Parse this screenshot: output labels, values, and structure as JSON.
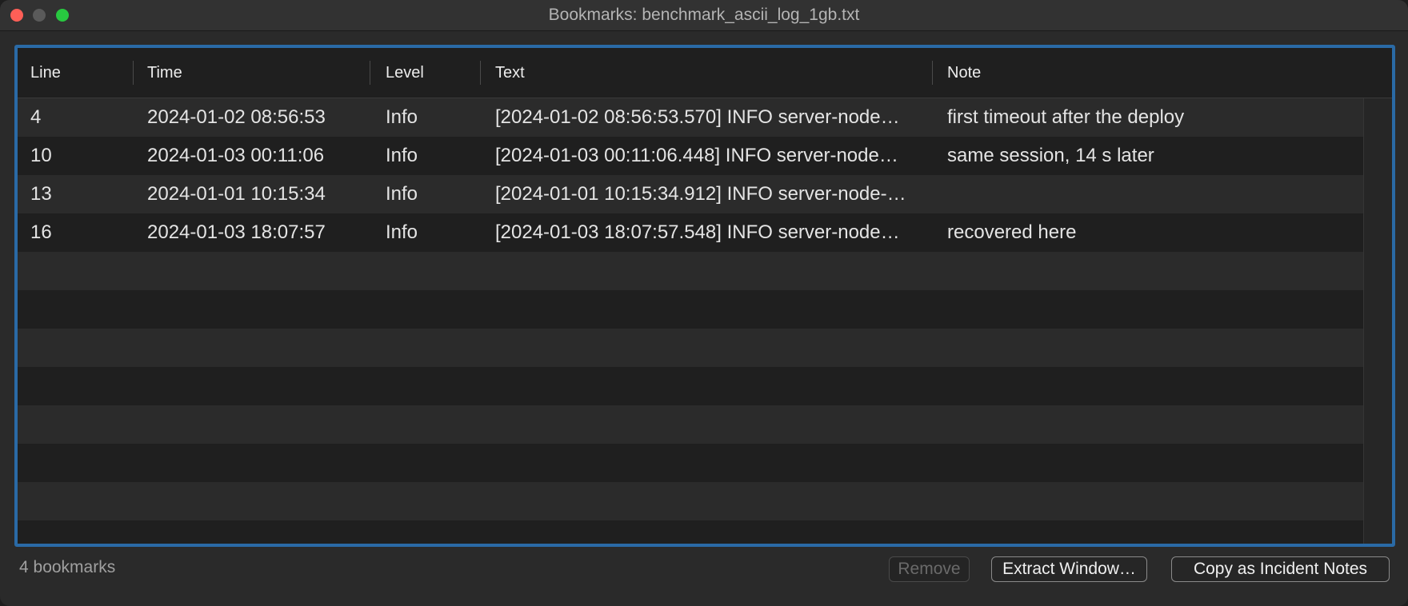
{
  "window": {
    "title": "Bookmarks: benchmark_ascii_log_1gb.txt"
  },
  "table": {
    "columns": [
      "Line",
      "Time",
      "Level",
      "Text",
      "Note"
    ],
    "rows": [
      {
        "line": "4",
        "time": "2024-01-02 08:56:53",
        "level": "Info",
        "text": "[2024-01-02 08:56:53.570] INFO  server-node…",
        "note": "first timeout after the deploy"
      },
      {
        "line": "10",
        "time": "2024-01-03 00:11:06",
        "level": "Info",
        "text": "[2024-01-03 00:11:06.448] INFO  server-node…",
        "note": "same session, 14 s later"
      },
      {
        "line": "13",
        "time": "2024-01-01 10:15:34",
        "level": "Info",
        "text": "[2024-01-01 10:15:34.912] INFO  server-node-…",
        "note": ""
      },
      {
        "line": "16",
        "time": "2024-01-03 18:07:57",
        "level": "Info",
        "text": "[2024-01-03 18:07:57.548] INFO  server-node…",
        "note": "recovered here"
      }
    ]
  },
  "footer": {
    "count_label": "4 bookmarks",
    "remove_label": "Remove",
    "extract_label": "Extract Window…",
    "copy_label": "Copy as Incident Notes"
  },
  "colors": {
    "accent": "#2a6aa6",
    "close": "#ff5f57",
    "maximize": "#28c840"
  }
}
